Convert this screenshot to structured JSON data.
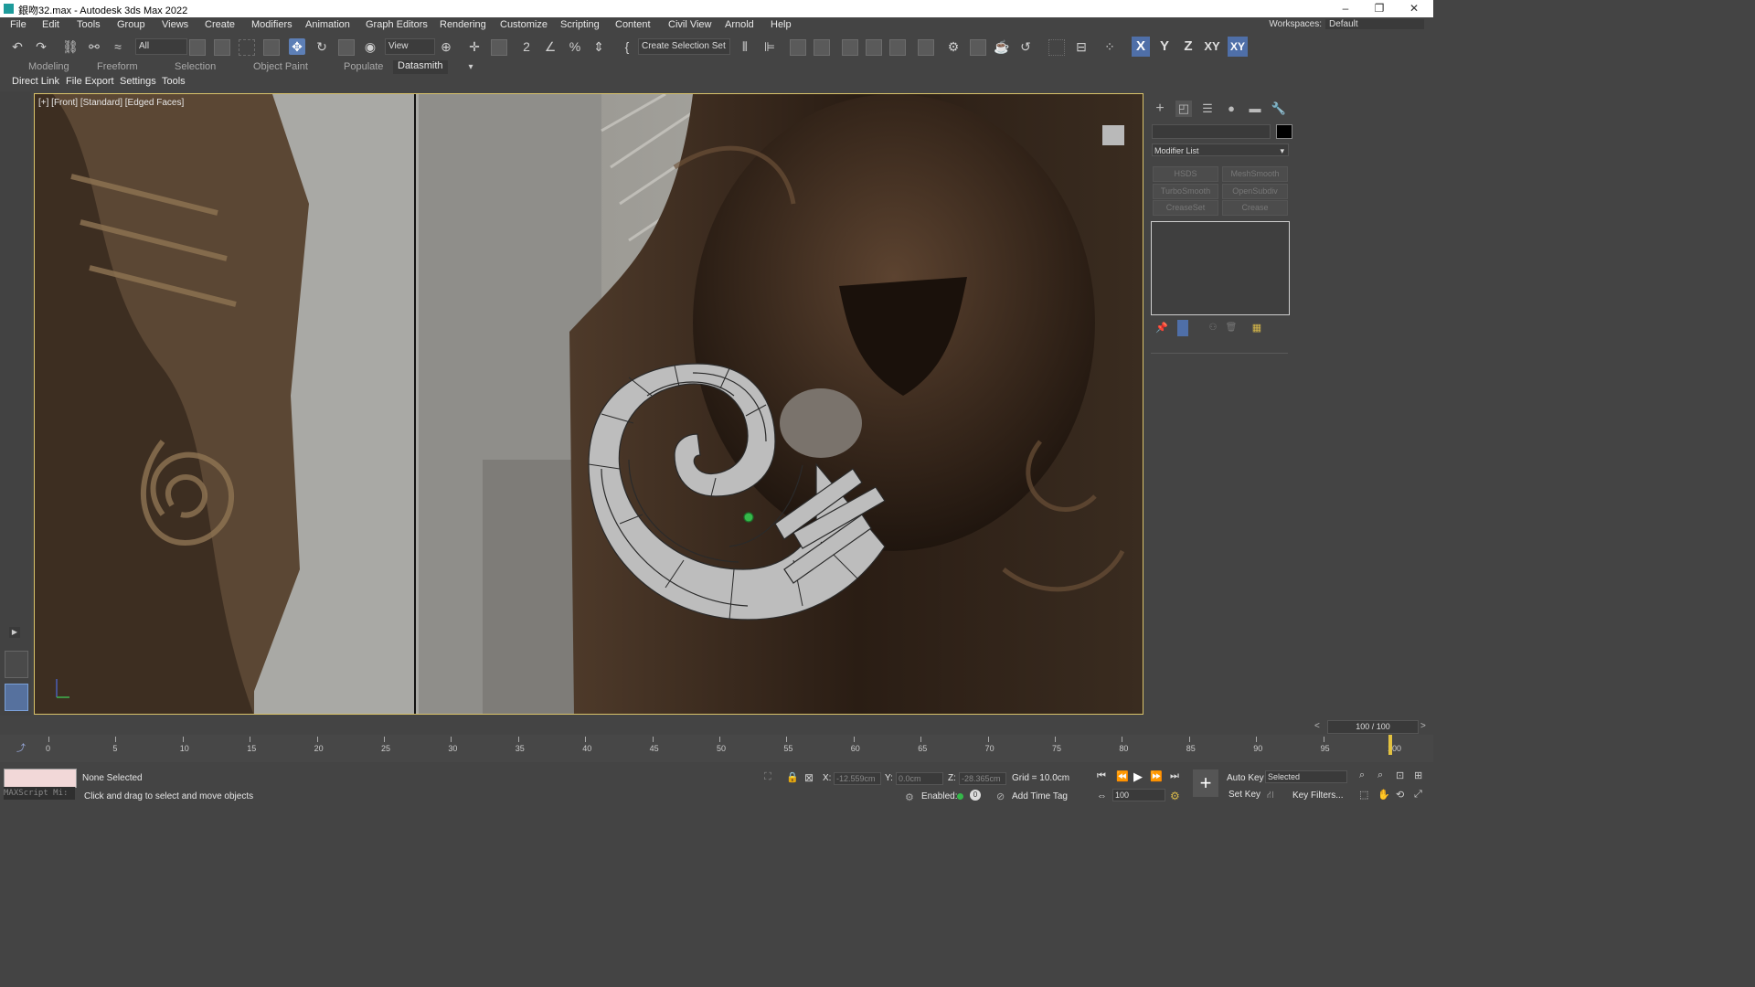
{
  "window": {
    "title": "銀吻32.max - Autodesk 3ds Max 2022",
    "min_glyph": "–",
    "restore_glyph": "❐",
    "close_glyph": "✕"
  },
  "menu": {
    "items": [
      "File",
      "Edit",
      "Tools",
      "Group",
      "Views",
      "Create",
      "Modifiers",
      "Animation",
      "Graph Editors",
      "Rendering",
      "Customize",
      "Scripting",
      "Content",
      "Civil View",
      "Arnold",
      "Help"
    ],
    "workspaces_label": "Workspaces:",
    "workspaces_value": "Default"
  },
  "toolbar": {
    "filter_value": "All",
    "ref_coord_value": "View",
    "selection_set_value": "Create Selection Set",
    "axes": [
      "X",
      "Y",
      "Z",
      "XY",
      "XY"
    ]
  },
  "ribbon": {
    "tabs": [
      "Modeling",
      "Freeform",
      "Selection",
      "Object Paint",
      "Populate",
      "Datasmith"
    ],
    "active": "Datasmith"
  },
  "submenu": {
    "items": [
      "Direct Link",
      "File Export",
      "Settings",
      "Tools"
    ]
  },
  "viewport": {
    "label": "[+] [Front] [Standard] [Edged Faces]"
  },
  "command_panel": {
    "modifier_list_label": "Modifier List",
    "modifier_buttons": [
      "HSDS",
      "MeshSmooth",
      "TurboSmooth",
      "OpenSubdiv",
      "CreaseSet",
      "Crease"
    ]
  },
  "timeline": {
    "frame_display": "100 / 100",
    "current_frame": 100,
    "ticks": [
      "0",
      "5",
      "10",
      "15",
      "20",
      "25",
      "30",
      "35",
      "40",
      "45",
      "50",
      "55",
      "60",
      "65",
      "70",
      "75",
      "80",
      "85",
      "90",
      "95",
      "100"
    ]
  },
  "status": {
    "selection": "None Selected",
    "prompt": "Click and drag to select and move objects",
    "maxscript": "MAXScript Mi:",
    "x_label": "X:",
    "x_value": "-12.559cm",
    "y_label": "Y:",
    "y_value": "0.0cm",
    "z_label": "Z:",
    "z_value": "-28.365cm",
    "grid": "Grid = 10.0cm",
    "enabled_label": "Enabled:",
    "add_time_tag": "Add Time Tag",
    "auto_key": "Auto Key",
    "set_key": "Set Key",
    "key_mode_value": "Selected",
    "key_filters": "Key Filters...",
    "frame_field": "100",
    "time_counter": "0"
  },
  "colors": {
    "accent_axis": "#4f6fa8",
    "viewport_border": "#d9c36a",
    "pivot": "#35b84a"
  }
}
